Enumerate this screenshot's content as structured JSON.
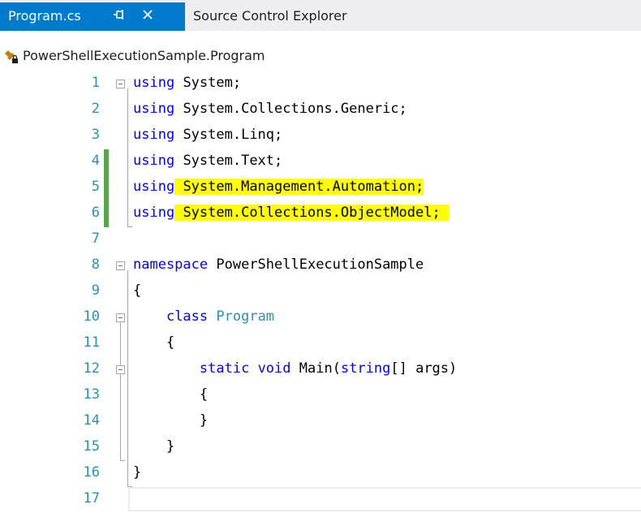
{
  "tabs": {
    "active_label": "Program.cs",
    "pin_glyph": "⯑",
    "close_glyph": "✕",
    "inactive_label": "Source Control Explorer"
  },
  "nav": {
    "icon": "class-icon",
    "label": "PowerShellExecutionSample.Program"
  },
  "editor": {
    "lines": [
      {
        "num": "1",
        "text": "using System;"
      },
      {
        "num": "2",
        "text": "using System.Collections.Generic;"
      },
      {
        "num": "3",
        "text": "using System.Linq;"
      },
      {
        "num": "4",
        "text": "using System.Text;"
      },
      {
        "num": "5",
        "text": "using System.Management.Automation;"
      },
      {
        "num": "6",
        "text": "using System.Collections.ObjectModel;"
      },
      {
        "num": "7",
        "text": ""
      },
      {
        "num": "8",
        "text": "namespace PowerShellExecutionSample"
      },
      {
        "num": "9",
        "text": "{"
      },
      {
        "num": "10",
        "text": "    class Program"
      },
      {
        "num": "11",
        "text": "    {"
      },
      {
        "num": "12",
        "text": "        static void Main(string[] args)"
      },
      {
        "num": "13",
        "text": "        {"
      },
      {
        "num": "14",
        "text": "        }"
      },
      {
        "num": "15",
        "text": "    }"
      },
      {
        "num": "16",
        "text": "}"
      },
      {
        "num": "17",
        "text": ""
      }
    ],
    "tokens": {
      "using": "using",
      "ns_system": "System;",
      "ns_collections_generic": "System.Collections.Generic;",
      "ns_linq": "System.Linq;",
      "ns_text": "System.Text;",
      "ns_management_automation": "System.Management.Automation;",
      "ns_collections_objectmodel": "System.Collections.ObjectModel;",
      "namespace_kw": "namespace",
      "namespace_name": "PowerShellExecutionSample",
      "open_brace": "{",
      "close_brace": "}",
      "class_kw": "class",
      "class_name": "Program",
      "static_kw": "static",
      "void_kw": "void",
      "main_name": "Main(",
      "string_kw": "string",
      "params_rest": "[] args)"
    },
    "changed_lines": [
      4,
      5,
      6
    ],
    "highlighted_lines": [
      5,
      6
    ],
    "colors": {
      "keyword": "#0000ff",
      "type": "#2b91af",
      "line_number": "#2b91af",
      "highlight": "#ffff00",
      "change_bar": "#57a64a",
      "tab_active": "#007acc"
    }
  }
}
